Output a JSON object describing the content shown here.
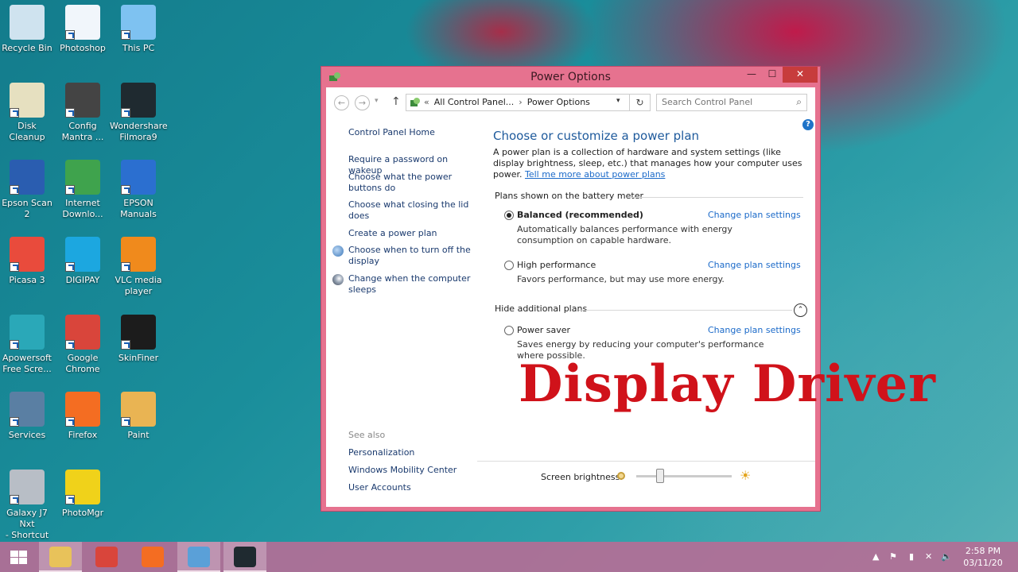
{
  "desktop": {
    "icons": [
      {
        "label": "Recycle Bin",
        "icon": "recycle-bin-icon",
        "color": "#cfe3ef"
      },
      {
        "label": "Photoshop",
        "icon": "photoshop-icon",
        "color": "#f1f6fb"
      },
      {
        "label": "This PC",
        "icon": "this-pc-icon",
        "color": "#7ec2f1"
      },
      {
        "label": "Disk Cleanup",
        "icon": "disk-cleanup-icon",
        "color": "#e6e0c0"
      },
      {
        "label": "Config\nMantra ...",
        "icon": "config-mantra-icon",
        "color": "#444444"
      },
      {
        "label": "Wondershare\nFilmora9",
        "icon": "filmora-icon",
        "color": "#1f2a30"
      },
      {
        "label": "Epson Scan 2",
        "icon": "epson-scan-icon",
        "color": "#2a5db0"
      },
      {
        "label": "Internet\nDownlo...",
        "icon": "idm-icon",
        "color": "#3fa34d"
      },
      {
        "label": "EPSON\nManuals",
        "icon": "epson-manuals-icon",
        "color": "#2b6fd0"
      },
      {
        "label": "Picasa 3",
        "icon": "picasa-icon",
        "color": "#e94b3c"
      },
      {
        "label": "DIGIPAY",
        "icon": "digipay-icon",
        "color": "#1ca7e0"
      },
      {
        "label": "VLC media\nplayer",
        "icon": "vlc-icon",
        "color": "#f08a1c"
      },
      {
        "label": "Apowersoft\nFree Scre...",
        "icon": "apowersoft-icon",
        "color": "#2aa8b8"
      },
      {
        "label": "Google\nChrome",
        "icon": "chrome-icon",
        "color": "#d9453b"
      },
      {
        "label": "SkinFiner",
        "icon": "skinfiner-icon",
        "color": "#1c1c1c"
      },
      {
        "label": "Services",
        "icon": "services-icon",
        "color": "#5a7fa3"
      },
      {
        "label": "Firefox",
        "icon": "firefox-icon",
        "color": "#f46d22"
      },
      {
        "label": "Paint",
        "icon": "paint-icon",
        "color": "#e9b453"
      },
      {
        "label": "Galaxy J7 Nxt\n- Shortcut",
        "icon": "phone-icon",
        "color": "#b8bec6"
      },
      {
        "label": "PhotoMgr",
        "icon": "photomgr-icon",
        "color": "#f0d21a"
      }
    ]
  },
  "window": {
    "title": "Power Options",
    "minimize": "—",
    "maximize": "☐",
    "close": "✕"
  },
  "addressbar": {
    "back": "←",
    "forward": "→",
    "up": "↑",
    "crumb_prefix": "«",
    "crumb1": "All Control Panel...",
    "crumb_sep": "›",
    "crumb2": "Power Options",
    "dropdown": "▾",
    "refresh": "↻",
    "search_placeholder": "Search Control Panel",
    "search_glyph": "⌕"
  },
  "help_glyph": "?",
  "left_pane": {
    "home": "Control Panel Home",
    "links": [
      "Require a password on wakeup",
      "Choose what the power buttons do",
      "Choose what closing the lid does",
      "Create a power plan",
      "Choose when to turn off the display",
      "Change when the computer sleeps"
    ],
    "see_also": "See also",
    "see_also_links": [
      "Personalization",
      "Windows Mobility Center",
      "User Accounts"
    ]
  },
  "main": {
    "title": "Choose or customize a power plan",
    "desc": "A power plan is a collection of hardware and system settings (like display brightness, sleep, etc.) that manages how your computer uses power.",
    "desc_link": "Tell me more about power plans",
    "group1": "Plans shown on the battery meter",
    "group2": "Hide additional plans",
    "collapse_glyph": "⌃",
    "plans": [
      {
        "name": "Balanced (recommended)",
        "desc": "Automatically balances performance with energy consumption on capable hardware.",
        "link": "Change plan settings",
        "selected": true
      },
      {
        "name": "High performance",
        "desc": "Favors performance, but may use more energy.",
        "link": "Change plan settings",
        "selected": false
      },
      {
        "name": "Power saver",
        "desc": "Saves energy by reducing your computer's performance where possible.",
        "link": "Change plan settings",
        "selected": false
      }
    ],
    "brightness_label": "Screen brightness:",
    "brightness_level": 0.25,
    "bright_glyph": "☀"
  },
  "overlay_text": "Display Driver",
  "taskbar": {
    "items": [
      {
        "icon": "file-explorer-icon",
        "color": "#e8c25a",
        "active": true
      },
      {
        "icon": "chrome-icon",
        "color": "#d9453b",
        "active": false
      },
      {
        "icon": "firefox-icon",
        "color": "#f46d22",
        "active": false
      },
      {
        "icon": "control-panel-icon",
        "color": "#5aa0d8",
        "active": true
      },
      {
        "icon": "filmora-icon",
        "color": "#1f2a30",
        "active": true
      }
    ],
    "tray": {
      "chevron": "▲",
      "flag": "⚑",
      "battery": "▮",
      "network": "✕",
      "volume": "🔈"
    },
    "time": "2:58 PM",
    "date": "03/11/20"
  }
}
